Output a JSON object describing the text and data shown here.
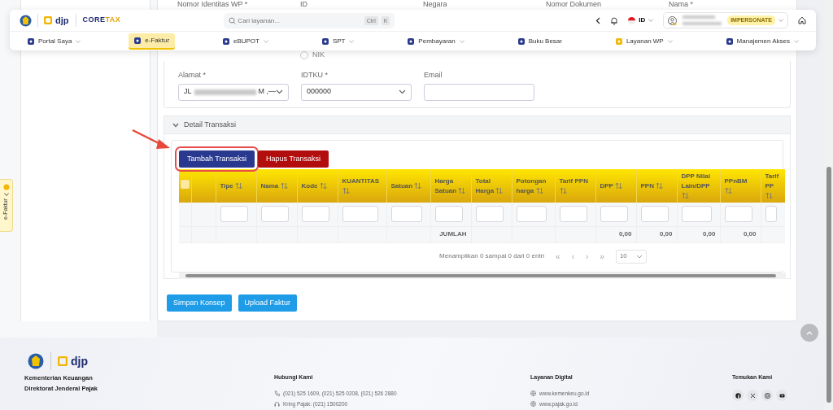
{
  "side_tab": {
    "label": "e-Faktur"
  },
  "navbar": {
    "brand": {
      "djp": "djp",
      "coretax": [
        "CORE",
        "TAX"
      ]
    },
    "search_placeholder": "Cari layanan...",
    "shortcut": [
      "Ctrl",
      "K"
    ],
    "language": "ID",
    "badge": "IMPERSONATE",
    "menu": [
      {
        "label": "Portal Saya",
        "dropdown": true,
        "selected": false,
        "color": "#2b3a8c"
      },
      {
        "label": "e-Faktur",
        "dropdown": false,
        "selected": true,
        "color": "#2b3a8c"
      },
      {
        "label": "eBUPOT",
        "dropdown": true,
        "selected": false,
        "color": "#2b3a8c"
      },
      {
        "label": "SPT",
        "dropdown": true,
        "selected": false,
        "color": "#2b3a8c"
      },
      {
        "label": "Pembayaran",
        "dropdown": true,
        "selected": false,
        "color": "#2b3a8c"
      },
      {
        "label": "Buku Besar",
        "dropdown": false,
        "selected": false,
        "color": "#2b3a8c"
      },
      {
        "label": "Layanan WP",
        "dropdown": true,
        "selected": false,
        "color": "#f2b705"
      },
      {
        "label": "Manajemen Akses",
        "dropdown": true,
        "selected": false,
        "color": "#2b3a8c"
      }
    ]
  },
  "form": {
    "top_labels": [
      "Nomor Identitas WP *",
      "ID",
      "Negara",
      "Nomor Dokumen",
      "Nama *"
    ],
    "radio": {
      "label": "NIK",
      "checked": false
    },
    "fields": [
      {
        "label": "Alamat *",
        "kind": "select",
        "value": "JL",
        "redacted": true,
        "suffix": "M ,—"
      },
      {
        "label": "IDTKU *",
        "kind": "select",
        "value": "000000"
      },
      {
        "label": "Email",
        "kind": "input"
      }
    ]
  },
  "section": {
    "title": "Detail Transaksi",
    "expanded": true
  },
  "table_buttons": [
    {
      "label": "Tambah Transaksi",
      "kind": "primary",
      "highlighted": true
    },
    {
      "label": "Hapus Transaksi",
      "kind": "danger",
      "highlighted": false
    }
  ],
  "table": {
    "columns": [
      {
        "kind": "checkbox",
        "checked": false
      },
      {
        "kind": "blank"
      },
      {
        "kind": "data",
        "label": "Tipe",
        "sortable": true,
        "filter": true
      },
      {
        "kind": "data",
        "label": "Nama",
        "sortable": true,
        "filter": true
      },
      {
        "kind": "data",
        "label": "Kode",
        "sortable": true,
        "filter": true
      },
      {
        "kind": "data",
        "label": "KUANTITAS",
        "sortable": true,
        "filter": true
      },
      {
        "kind": "data",
        "label": "Satuan",
        "sortable": true,
        "filter": true
      },
      {
        "kind": "data",
        "label": "Harga Satuan",
        "sortable": true,
        "filter": true,
        "total": "JUMLAH"
      },
      {
        "kind": "data",
        "label": "Total Harga",
        "sortable": true,
        "filter": true
      },
      {
        "kind": "data",
        "label": "Potongan harga",
        "sortable": true,
        "filter": true
      },
      {
        "kind": "data",
        "label": "Tarif PPN",
        "sortable": true,
        "filter": true
      },
      {
        "kind": "data",
        "label": "DPP",
        "sortable": true,
        "filter": true,
        "total": "0,00"
      },
      {
        "kind": "data",
        "label": "PPN",
        "sortable": true,
        "filter": true,
        "total": "0,00"
      },
      {
        "kind": "data",
        "label": "DPP Nilai Lain/DPP",
        "sortable": true,
        "filter": true,
        "total": "0,00"
      },
      {
        "kind": "data",
        "label": "PPnBM",
        "sortable": true,
        "filter": true,
        "total": "0,00"
      },
      {
        "kind": "data",
        "label": "Tarif PP",
        "sortable": true,
        "filter": true
      }
    ],
    "info": "Menampilkan 0 sampai 0 dari 0 entri",
    "pager": [
      {
        "label": "«",
        "disabled": true
      },
      {
        "label": "‹",
        "disabled": true
      },
      {
        "label": "›",
        "disabled": true
      },
      {
        "label": "»",
        "disabled": true
      }
    ],
    "page_size": "10"
  },
  "actions": [
    "Simpan Konsep",
    "Upload Faktur"
  ],
  "footer": {
    "org": [
      "Kementerian Keuangan",
      "Direktorat Jenderal Pajak"
    ],
    "logo_text": "djp",
    "contact": {
      "title": "Hubungi Kami",
      "phone": "(021) 525 1609, (021) 525 0208, (021) 526 2880",
      "kring": "Kring Pajak: (021) 1500200"
    },
    "digital": {
      "title": "Layanan Digital",
      "links": [
        "www.kemenkeu.go.id",
        "www.pajak.go.id"
      ]
    },
    "social": {
      "title": "Temukan Kami",
      "items": [
        {
          "kind": "facebook"
        },
        {
          "kind": "x"
        },
        {
          "kind": "instagram"
        },
        {
          "kind": "youtube"
        }
      ]
    }
  }
}
